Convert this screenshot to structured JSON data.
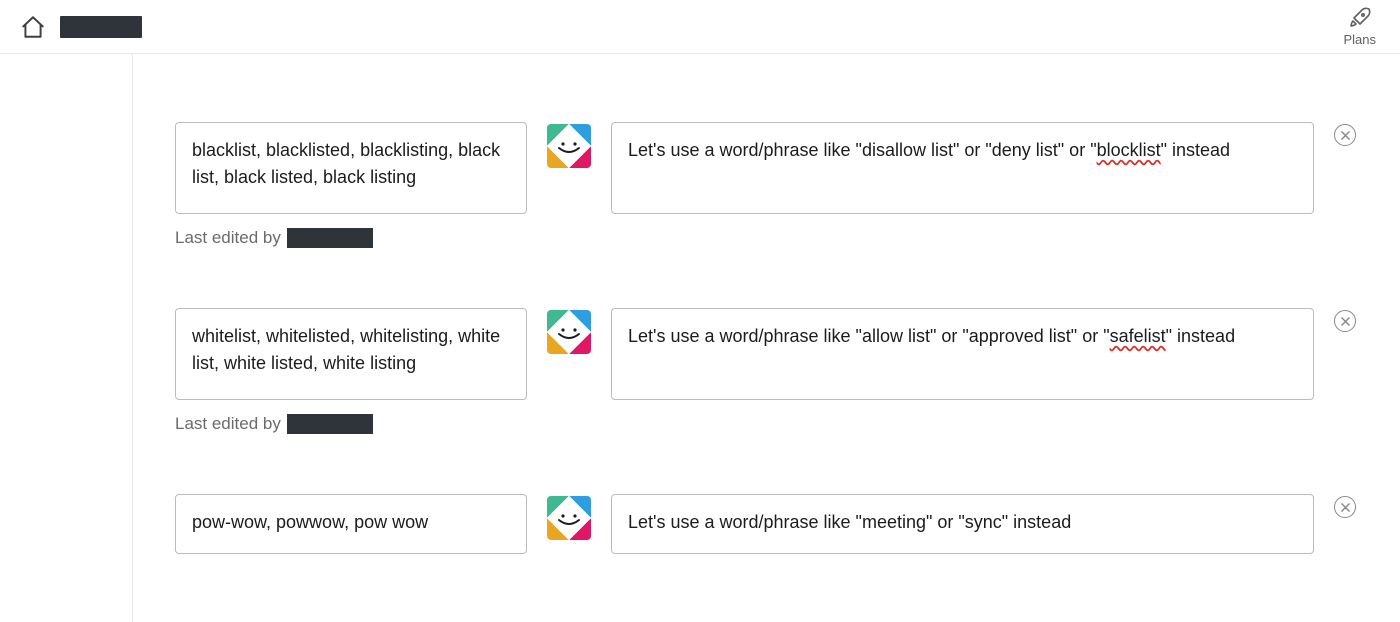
{
  "header": {
    "plans_label": "Plans"
  },
  "labels": {
    "last_edited_prefix": "Last edited by"
  },
  "rules": [
    {
      "triggers_text": "blacklist, blacklisted, blacklisting, black list, black listed, black listing",
      "response_prefix": "Let's use a word/phrase like \"disallow list\" or \"deny list\" or \"",
      "response_squiggle": "blocklist",
      "response_suffix": "\" instead",
      "show_meta": true,
      "short": false
    },
    {
      "triggers_text": "whitelist, whitelisted, whitelisting, white list, white listed, white listing",
      "response_prefix": "Let's use a word/phrase like \"allow list\" or \"approved list\" or \"",
      "response_squiggle": "safelist",
      "response_suffix": "\" instead",
      "show_meta": true,
      "short": false
    },
    {
      "triggers_text": "pow-wow, powwow, pow wow",
      "response_prefix": "Let's use a word/phrase like \"meeting\" or \"sync\" instead",
      "response_squiggle": "",
      "response_suffix": "",
      "show_meta": false,
      "short": true
    }
  ]
}
